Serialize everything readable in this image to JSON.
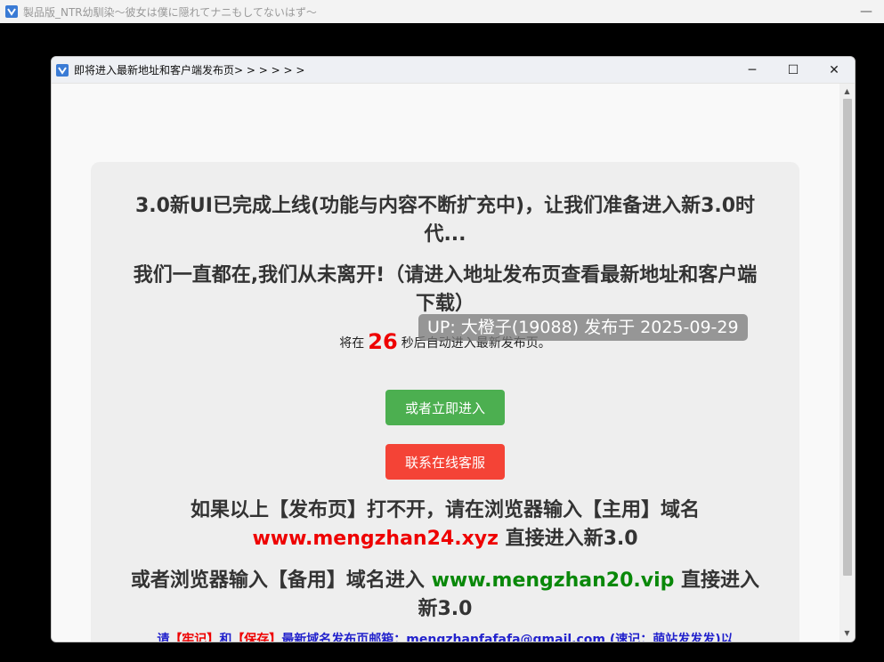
{
  "outer_window": {
    "title": "製品版_NTR幼馴染～彼女は僕に隠れてナニもしてないはず～",
    "minimize": "—"
  },
  "dialog": {
    "title": "即将进入最新地址和客户端发布页> > > > > >",
    "min": "─",
    "max": "☐",
    "close": "✕"
  },
  "card": {
    "heading1": "3.0新UI已完成上线(功能与内容不断扩充中)，让我们准备进入新3.0时代...",
    "heading2": "我们一直都在,我们从未离开!（请进入地址发布页查看最新地址和客户端下载）",
    "countdown_prefix": "将在",
    "countdown_value": "26",
    "countdown_suffix": "秒后自动进入最新发布页。",
    "enter_button": "或者立即进入",
    "support_button": "联系在线客服",
    "main_domain_text": "如果以上【发布页】打不开，请在浏览器输入【主用】域名",
    "main_domain_url": "www.mengzhan24.xyz",
    "main_domain_suffix": "直接进入新3.0",
    "backup_domain_text": "或者浏览器输入【备用】域名进入",
    "backup_domain_url": "www.mengzhan20.vip",
    "backup_domain_suffix": "直接进入新3.0",
    "bottom_p1": "请",
    "bottom_red1": "【牢记】",
    "bottom_p2": "和",
    "bottom_red2": "【保存】",
    "bottom_p3": "最新域名发布页邮箱：mengzhanfafafa@gmail.com (速记：萌站发发发)以"
  },
  "overlay": {
    "uploader": "UP: 大橙子(19088) 发布于 2025-09-29"
  },
  "colors": {
    "green_button": "#4caf50",
    "red_button": "#f44336",
    "countdown": "#ee0000"
  }
}
